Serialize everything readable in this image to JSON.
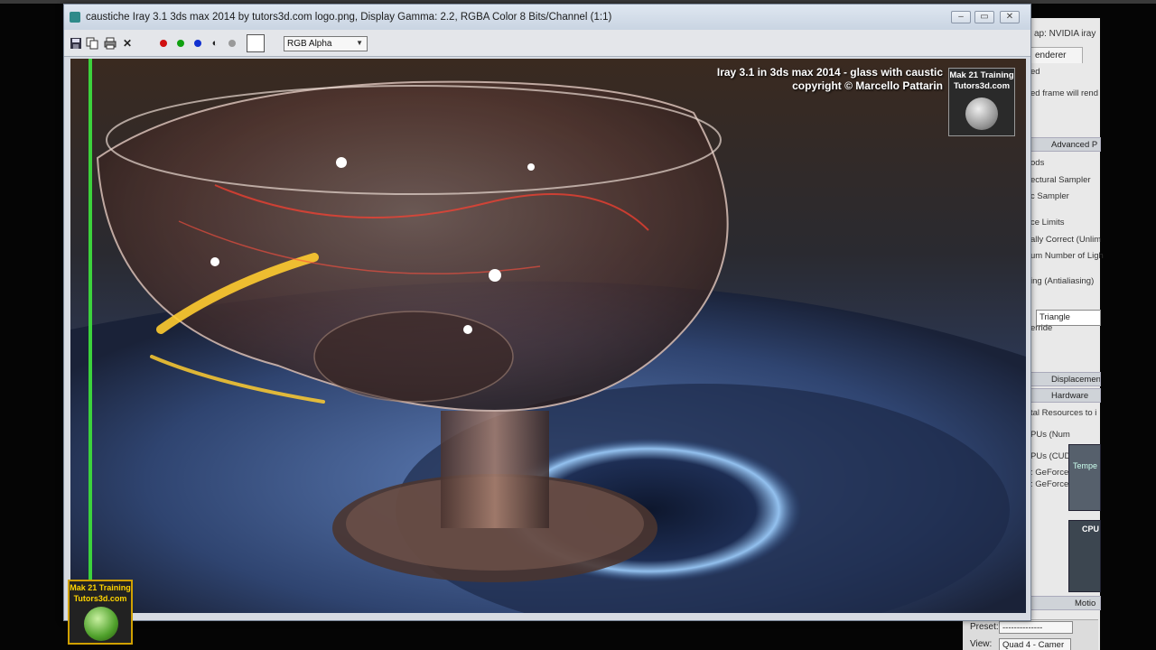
{
  "window": {
    "title": "caustiche Iray 3.1 3ds max 2014 by tutors3d.com logo.png, Display Gamma: 2.2, RGBA Color 8 Bits/Channel (1:1)"
  },
  "toolbar": {
    "channel_select": "RGB Alpha",
    "channel_colors": {
      "red": "#d01010",
      "green": "#10a010",
      "blue": "#1030d0"
    }
  },
  "render": {
    "caption_line1": "Iray 3.1 in 3ds max 2014 - glass with caustic",
    "caption_line2": "copyright © Marcello Pattarin",
    "logo_line1": "Mak 21 Training",
    "logo_line2": "Tutors3d.com"
  },
  "watermark": {
    "line1": "Mak 21 Training",
    "line2": "Tutors3d.com"
  },
  "render_setup": {
    "title": "ap: NVIDIA iray",
    "tab": "enderer",
    "lines": [
      "ed",
      "ed frame will rend",
      "ods",
      "ectural Sampler",
      "c Sampler",
      "ce Limits",
      "ally Correct (Unlim",
      "um Number of Ligh",
      "ing (Antialiasing)",
      "erride",
      "tal Resources to i",
      "PUs (Num",
      "PUs (CUDA",
      ": GeForce",
      ": GeForce"
    ],
    "rollouts": [
      "Advanced P",
      "Displacemen",
      "Hardware"
    ],
    "filter_select": "Triangle",
    "gpu_panel_label": "Tempe",
    "cpu_panel_label": "CPU",
    "bottom_rollout": "Motio"
  },
  "viewport_controls": {
    "preset_label": "Preset:",
    "preset_value": "--------------",
    "view_label": "View:",
    "view_value": "Quad 4 - Camer"
  }
}
